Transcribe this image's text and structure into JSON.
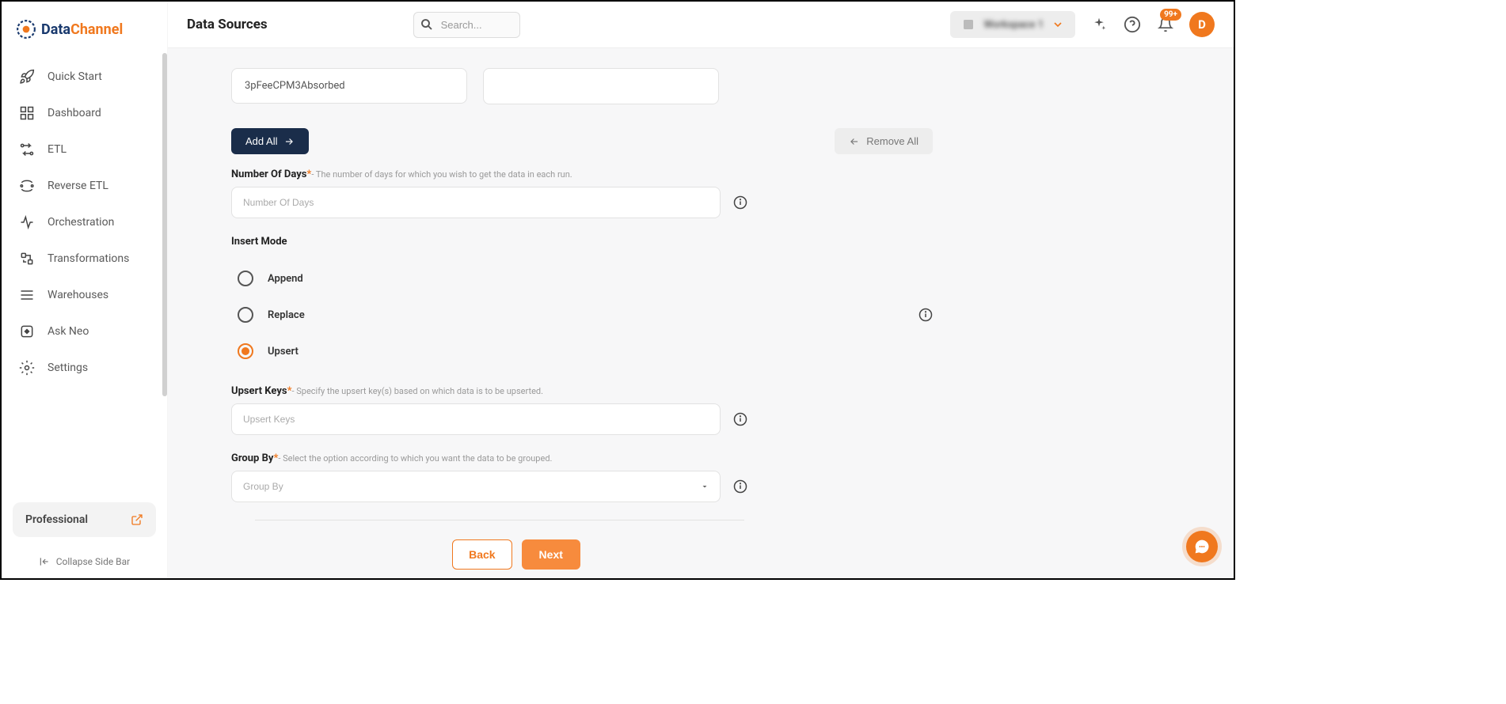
{
  "brand": {
    "part1": "Data",
    "part2": "Channel"
  },
  "header": {
    "title": "Data Sources",
    "search_placeholder": "Search...",
    "workspace_label": "Workspace 1",
    "notification_badge": "99+",
    "avatar_letter": "D"
  },
  "sidebar": {
    "items": [
      {
        "label": "Quick Start"
      },
      {
        "label": "Dashboard"
      },
      {
        "label": "ETL"
      },
      {
        "label": "Reverse ETL"
      },
      {
        "label": "Orchestration"
      },
      {
        "label": "Transformations"
      },
      {
        "label": "Warehouses"
      },
      {
        "label": "Ask Neo"
      },
      {
        "label": "Settings"
      }
    ],
    "plan": "Professional",
    "collapse": "Collapse Side Bar"
  },
  "form": {
    "tag_value": "3pFeeCPM3Absorbed",
    "add_all": "Add All",
    "remove_all": "Remove All",
    "num_days": {
      "label": "Number Of Days",
      "hint": "- The number of days for which you wish to get the data in each run.",
      "placeholder": "Number Of Days"
    },
    "insert_mode": {
      "label": "Insert Mode",
      "options": [
        {
          "label": "Append"
        },
        {
          "label": "Replace"
        },
        {
          "label": "Upsert"
        }
      ],
      "selected": "Upsert"
    },
    "upsert_keys": {
      "label": "Upsert Keys",
      "hint": "- Specify the upsert key(s) based on which data is to be upserted.",
      "placeholder": "Upsert Keys"
    },
    "group_by": {
      "label": "Group By",
      "hint": "- Select the option according to which you want the data to be grouped.",
      "placeholder": "Group By"
    },
    "back": "Back",
    "next": "Next"
  }
}
